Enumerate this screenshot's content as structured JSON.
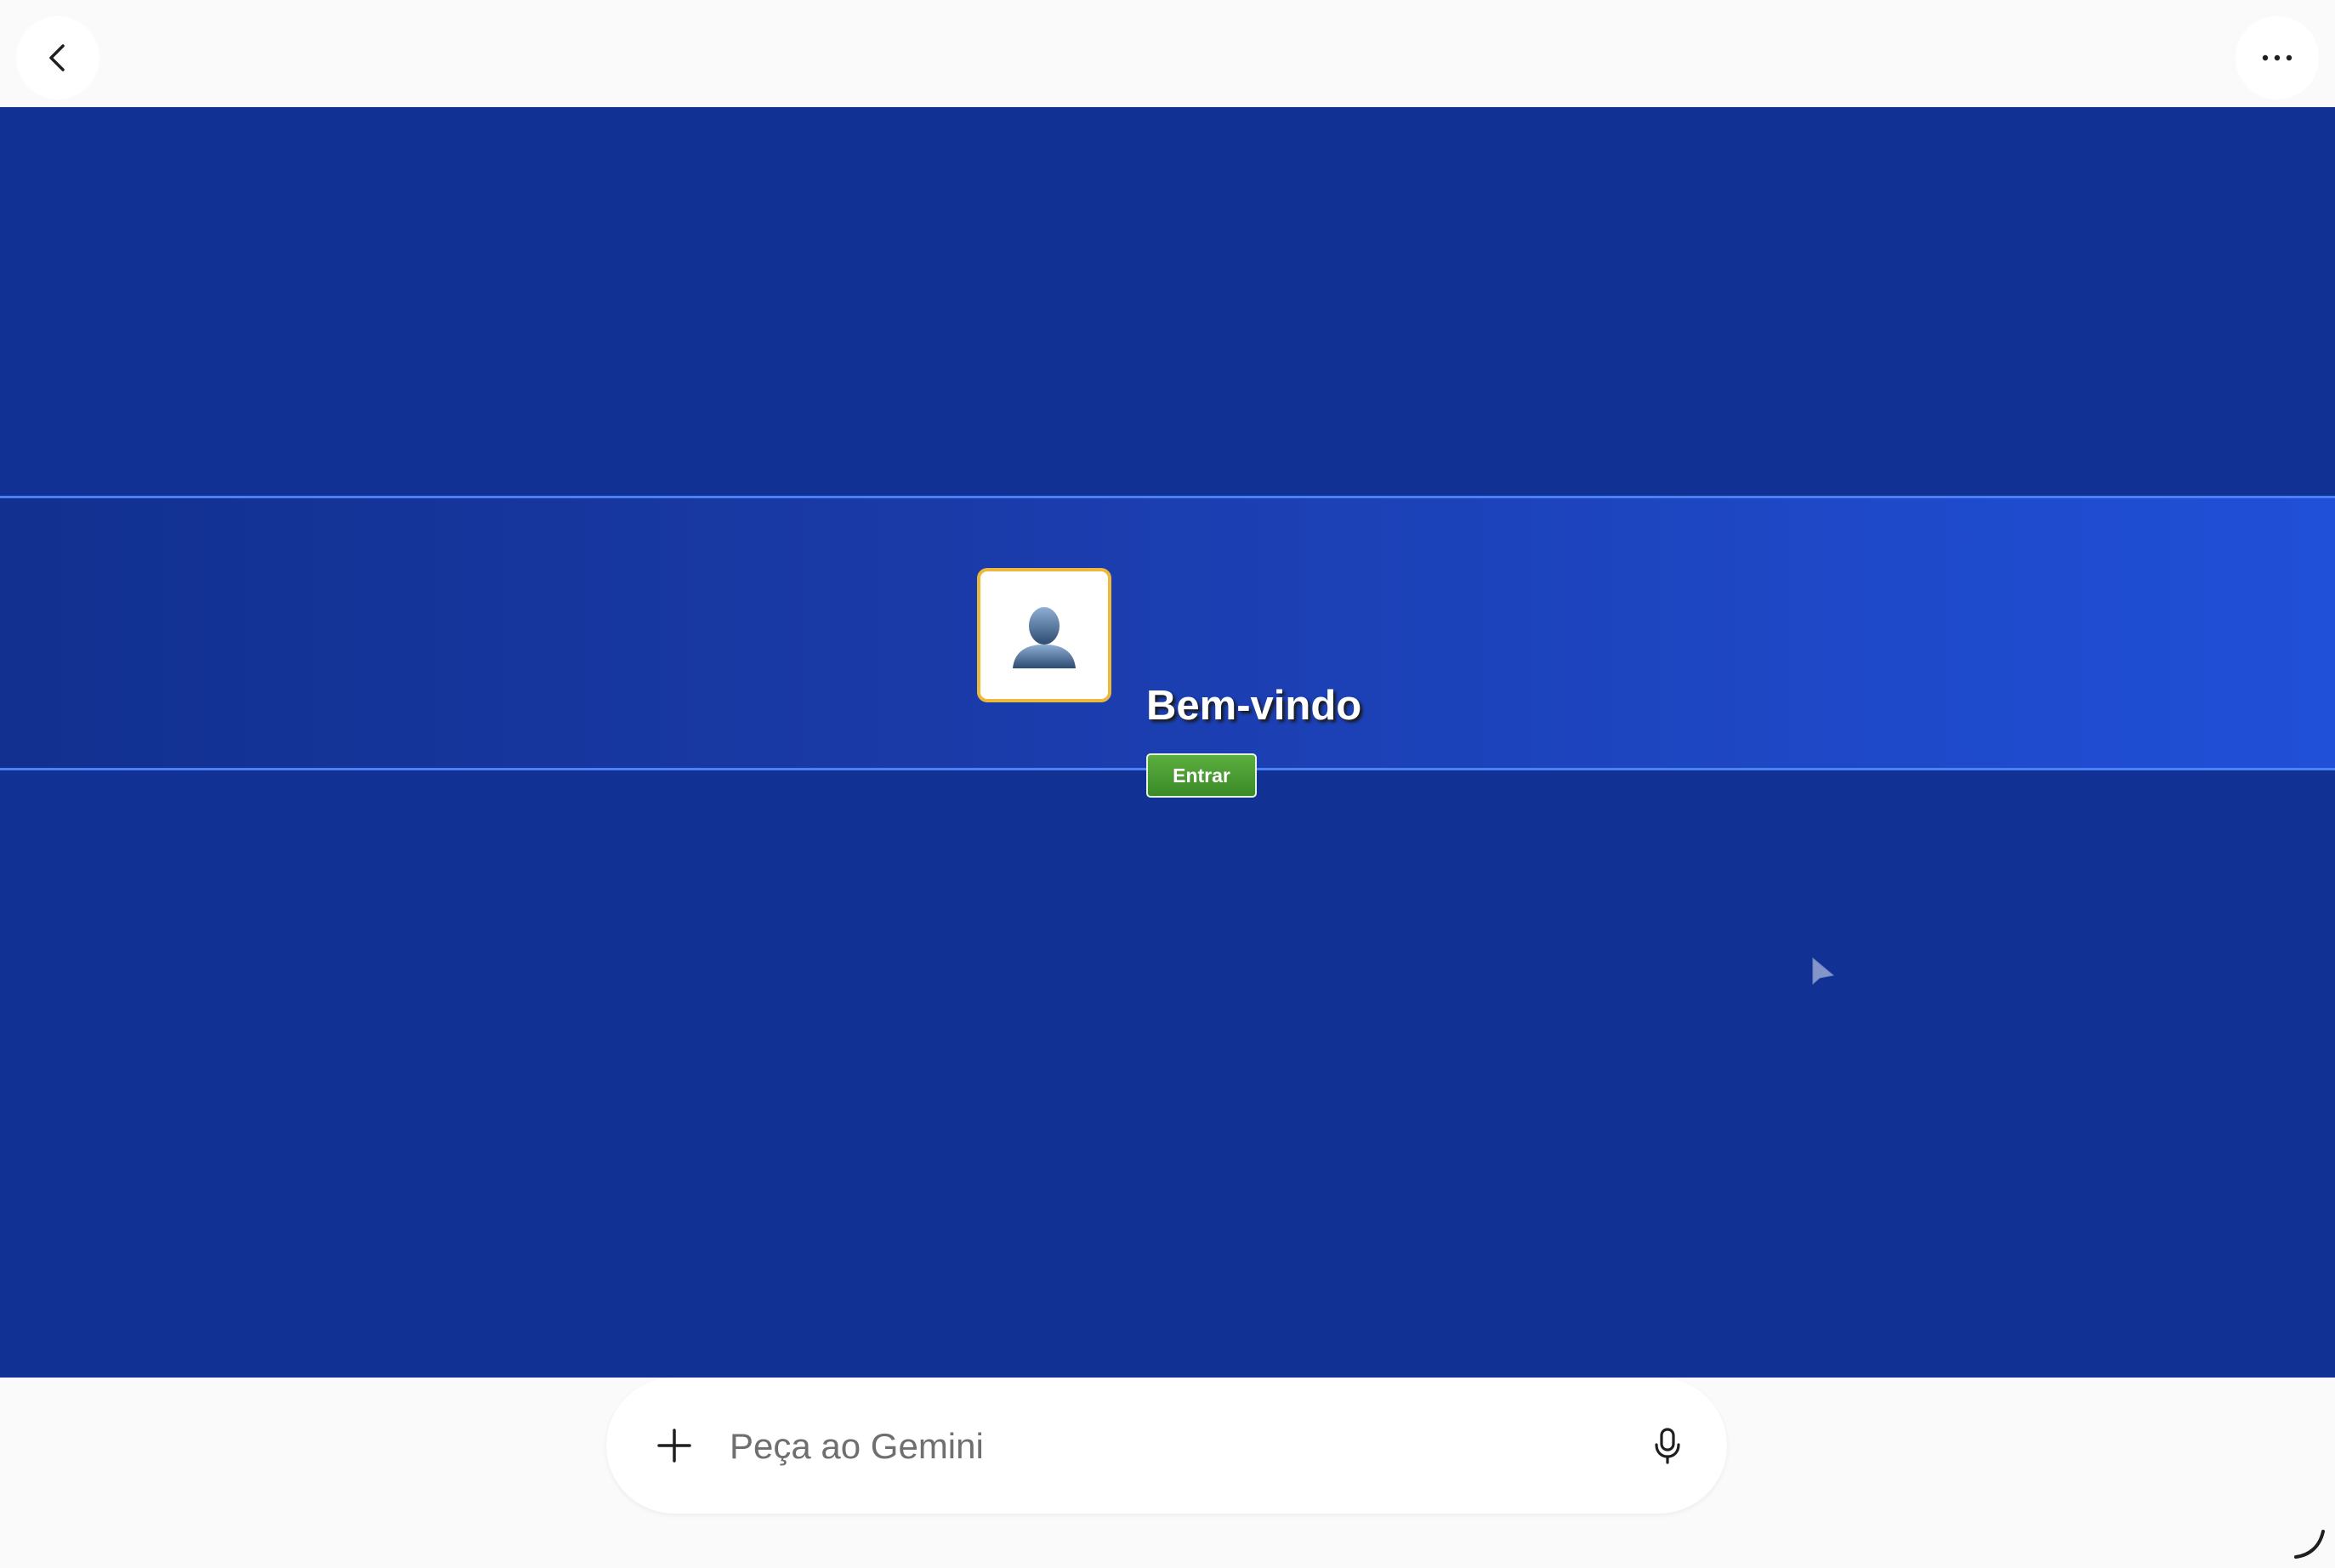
{
  "topbar": {
    "back_icon": "chevron-left-icon",
    "more_icon": "more-horizontal-icon"
  },
  "banner": {
    "avatar_icon": "user-silhouette-icon",
    "welcome_text": "Bem-vindo",
    "login_label": "Entrar"
  },
  "colors": {
    "stage_bg": "#113195",
    "banner_gradient_start": "#11308f",
    "banner_gradient_end": "#2050d8",
    "banner_border": "#4a82f5",
    "avatar_border": "#eeb93b",
    "login_button": "#4a9a33",
    "page_bg": "#fafafa"
  },
  "prompt": {
    "placeholder": "Peça ao Gemini",
    "add_icon": "plus-icon",
    "mic_icon": "microphone-icon"
  },
  "misc": {
    "pointer_icon": "mouse-pointer-icon",
    "resize_icon": "resize-handle-icon"
  }
}
